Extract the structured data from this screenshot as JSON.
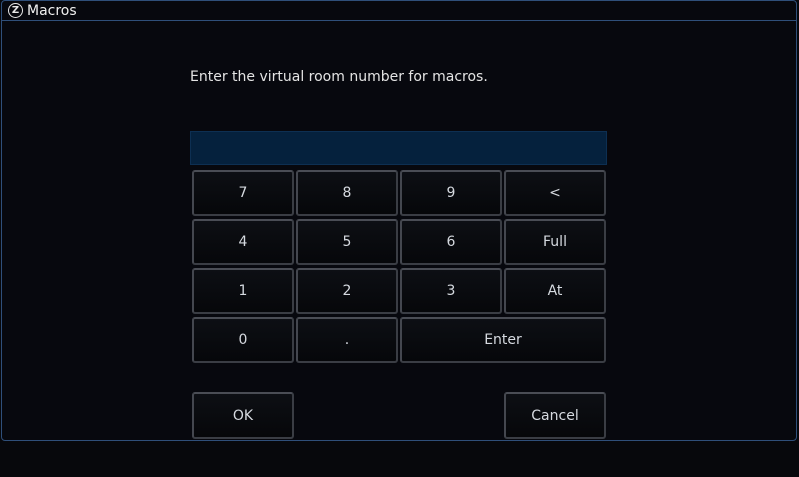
{
  "window": {
    "title": "Macros",
    "icon_glyph": "Z"
  },
  "dialog": {
    "prompt": "Enter the virtual room number for macros.",
    "input_value": "",
    "input_placeholder": ""
  },
  "keypad": {
    "k7": "7",
    "k8": "8",
    "k9": "9",
    "backspace": "<",
    "k4": "4",
    "k5": "5",
    "k6": "6",
    "full": "Full",
    "k1": "1",
    "k2": "2",
    "k3": "3",
    "at": "At",
    "k0": "0",
    "dot": ".",
    "enter": "Enter"
  },
  "actions": {
    "ok": "OK",
    "cancel": "Cancel"
  },
  "colors": {
    "background": "#07080c",
    "border_accent": "#2f4f7a",
    "entry_field": "#05213d",
    "key_text": "#d6dae0"
  }
}
